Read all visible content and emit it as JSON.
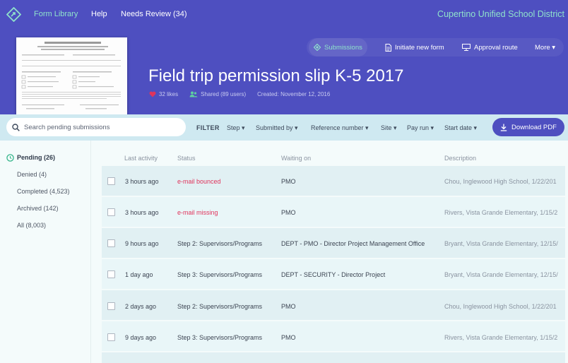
{
  "nav": {
    "items": [
      "Form Library",
      "Help",
      "Needs Review (34)"
    ],
    "district": "Cupertino Unified School District"
  },
  "actions": {
    "submissions": "Submissions",
    "initiate": "Initiate new form",
    "approval": "Approval route",
    "more": "More ▾"
  },
  "form": {
    "title": "Field trip permission slip K-5 2017",
    "likes": "32 likes",
    "shared": "Shared (89 users)",
    "created": "Created: November 12, 2016"
  },
  "filters": {
    "search_placeholder": "Search pending submissions",
    "filter_label": "FILTER",
    "items": [
      "Step ▾",
      "Submitted by ▾",
      "Reference number ▾",
      "Site ▾",
      "Pay run ▾",
      "Start date ▾"
    ],
    "download": "Download PDF"
  },
  "sidebar": {
    "items": [
      "Pending (26)",
      "Denied (4)",
      "Completed (4,523)",
      "Archived (142)",
      "All (8,003)"
    ]
  },
  "table": {
    "headers": [
      "Last activity",
      "Status",
      "Waiting on",
      "Description"
    ],
    "rows": [
      {
        "activity": "3 hours ago",
        "status": "e-mail bounced",
        "waiting": "PMO",
        "desc": "Chou, Inglewood High School, 1/22/201"
      },
      {
        "activity": "3 hours ago",
        "status": "e-mail missing",
        "waiting": "PMO",
        "desc": "Rivers, Vista Grande Elementary, 1/15/2"
      },
      {
        "activity": "9 hours ago",
        "status": "Step 2: Supervisors/Programs",
        "waiting": "DEPT - PMO - Director Project Management Office",
        "desc": "Bryant, Vista Grande Elementary, 12/15/"
      },
      {
        "activity": "1 day ago",
        "status": "Step 3: Supervisors/Programs",
        "waiting": "DEPT - SECURITY - Director Project",
        "desc": "Bryant, Vista Grande Elementary, 12/15/"
      },
      {
        "activity": "2 days ago",
        "status": "Step 2: Supervisors/Programs",
        "waiting": "PMO",
        "desc": "Chou, Inglewood High School, 1/22/201"
      },
      {
        "activity": "9 days ago",
        "status": "Step 3: Supervisors/Programs",
        "waiting": "PMO",
        "desc": "Rivers, Vista Grande Elementary, 1/15/2"
      }
    ]
  },
  "colors": {
    "header": "#4e4fc0",
    "accent": "#8fe2cb",
    "filterbar": "#cfe9f1",
    "error": "#e0345c"
  }
}
